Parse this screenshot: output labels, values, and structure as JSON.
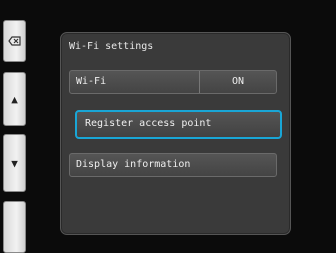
{
  "side_buttons": {
    "back_icon": "back-delete-icon",
    "up_glyph": "▲",
    "down_glyph": "▼"
  },
  "panel": {
    "title": "Wi-Fi settings",
    "wifi": {
      "label": "Wi-Fi",
      "value": "ON"
    },
    "register_label": "Register access point",
    "display_label": "Display information"
  },
  "colors": {
    "highlight": "#19a6d6",
    "panel_bg": "#3a3a3a",
    "screen_bg": "#0b0b0b"
  }
}
